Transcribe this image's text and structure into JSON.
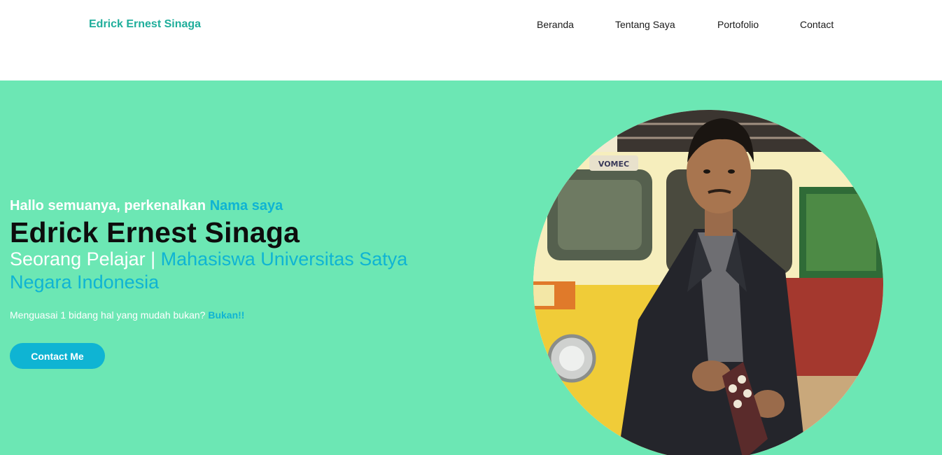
{
  "navbar": {
    "brand": "Edrick Ernest Sinaga",
    "links": [
      {
        "label": "Beranda"
      },
      {
        "label": "Tentang Saya"
      },
      {
        "label": "Portofolio"
      },
      {
        "label": "Contact"
      }
    ]
  },
  "hero": {
    "greeting_prefix": "Hallo semuanya, perkenalkan ",
    "greeting_accent": "Nama saya",
    "name": "Edrick Ernest Sinaga",
    "role_prefix": "Seorang Pelajar | ",
    "role_accent": "Mahasiswa Universitas Satya Negara Indonesia",
    "tagline_prefix": "Menguasai 1 bidang hal yang mudah bukan? ",
    "tagline_accent": "Bukan!!",
    "cta_label": "Contact Me",
    "photo_icon": "profile-photo",
    "van_sticker": "VOMEC"
  },
  "colors": {
    "brand": "#1fae9b",
    "hero_background": "#6ce7b4",
    "accent": "#0fb4d3",
    "text_dark": "#0d0d0d"
  }
}
